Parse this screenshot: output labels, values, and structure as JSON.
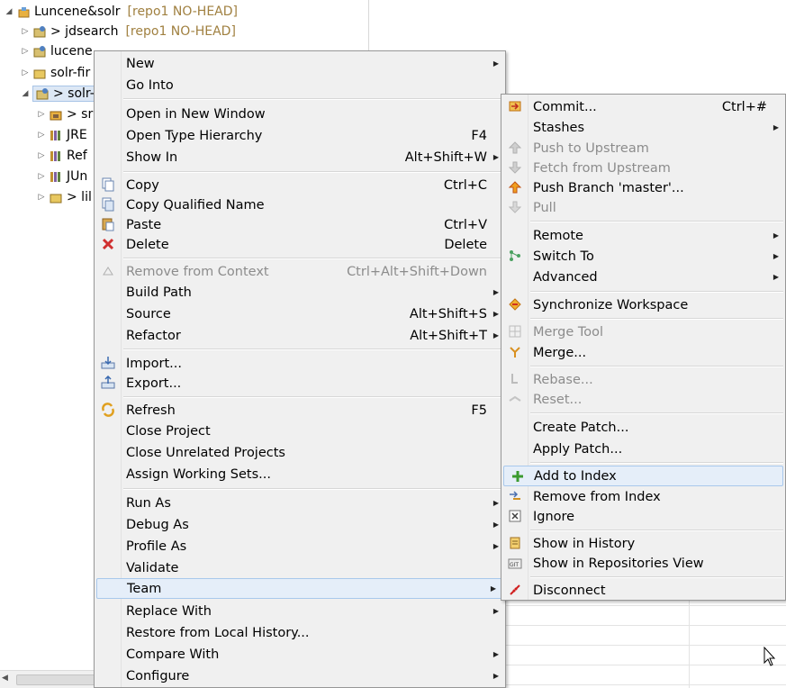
{
  "tree": {
    "items": [
      {
        "label": "Luncene&solr",
        "repo": "[repo1 NO-HEAD]"
      },
      {
        "label": "> jdsearch",
        "repo": "[repo1 NO-HEAD]"
      },
      {
        "label": "lucene"
      },
      {
        "label": "solr-fir"
      },
      {
        "label": "> solr-"
      },
      {
        "label": "> sr"
      },
      {
        "label": "JRE"
      },
      {
        "label": "Ref"
      },
      {
        "label": "JUn"
      },
      {
        "label": "> lil"
      }
    ]
  },
  "context_menu": {
    "new": "New",
    "go_into": "Go Into",
    "open_new_window": "Open in New Window",
    "open_type_hierarchy": "Open Type Hierarchy",
    "open_type_hierarchy_acc": "F4",
    "show_in": "Show In",
    "show_in_acc": "Alt+Shift+W",
    "copy": "Copy",
    "copy_acc": "Ctrl+C",
    "copy_qualified": "Copy Qualified Name",
    "paste": "Paste",
    "paste_acc": "Ctrl+V",
    "delete": "Delete",
    "delete_acc": "Delete",
    "remove_context": "Remove from Context",
    "remove_context_acc": "Ctrl+Alt+Shift+Down",
    "build_path": "Build Path",
    "source": "Source",
    "source_acc": "Alt+Shift+S",
    "refactor": "Refactor",
    "refactor_acc": "Alt+Shift+T",
    "import": "Import...",
    "export": "Export...",
    "refresh": "Refresh",
    "refresh_acc": "F5",
    "close_project": "Close Project",
    "close_unrelated": "Close Unrelated Projects",
    "assign_working_sets": "Assign Working Sets...",
    "run_as": "Run As",
    "debug_as": "Debug As",
    "profile_as": "Profile As",
    "validate": "Validate",
    "team": "Team",
    "replace_with": "Replace With",
    "restore_history": "Restore from Local History...",
    "compare_with": "Compare With",
    "configure": "Configure"
  },
  "team_menu": {
    "commit": "Commit...",
    "commit_acc": "Ctrl+#",
    "stashes": "Stashes",
    "push_upstream": "Push to Upstream",
    "fetch_upstream": "Fetch from Upstream",
    "push_branch": "Push Branch 'master'...",
    "pull": "Pull",
    "remote": "Remote",
    "switch_to": "Switch To",
    "advanced": "Advanced",
    "sync_workspace": "Synchronize Workspace",
    "merge_tool": "Merge Tool",
    "merge": "Merge...",
    "rebase": "Rebase...",
    "reset": "Reset...",
    "create_patch": "Create Patch...",
    "apply_patch": "Apply Patch...",
    "add_index": "Add to Index",
    "remove_index": "Remove from Index",
    "ignore": "Ignore",
    "show_history": "Show in History",
    "show_repos_view": "Show in Repositories View",
    "disconnect": "Disconnect"
  },
  "colors": {
    "menu_bg": "#f0f0f0",
    "highlight_bg": "#e5eef9",
    "highlight_border": "#a8c8ec",
    "disabled_text": "#8c8c8c",
    "repo_decoration": "#a08040"
  }
}
